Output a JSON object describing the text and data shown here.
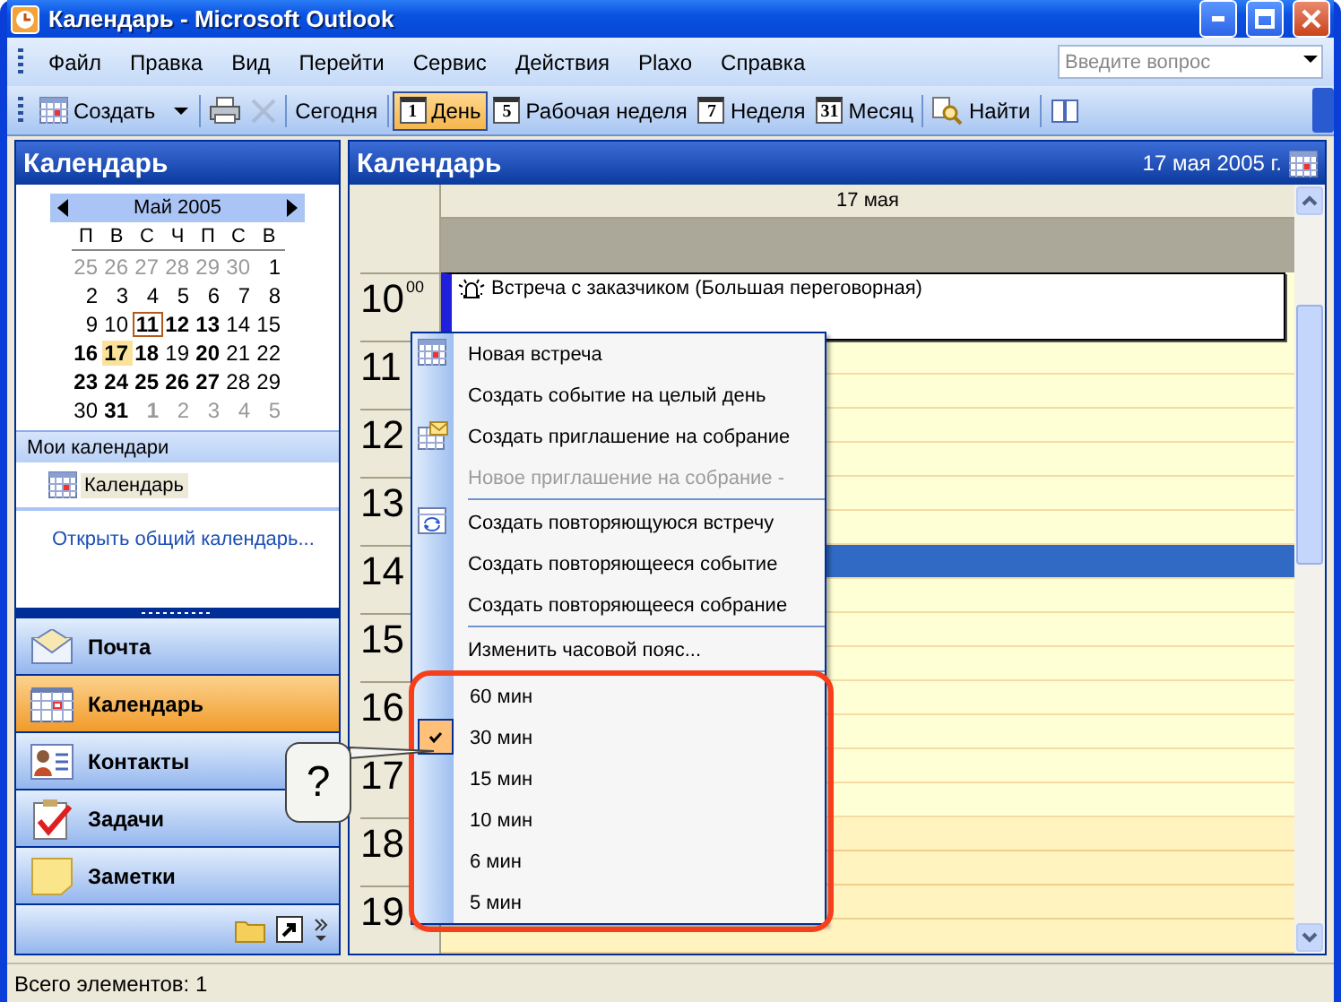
{
  "window": {
    "title": "Календарь - Microsoft Outlook"
  },
  "menu": [
    "Файл",
    "Правка",
    "Вид",
    "Перейти",
    "Сервис",
    "Действия",
    "Plaxo",
    "Справка"
  ],
  "help_search": {
    "placeholder": "Введите вопрос"
  },
  "toolbar": [
    {
      "kind": "new",
      "label": "Создать",
      "selected": false,
      "disabled": false
    },
    {
      "kind": "print",
      "selected": false,
      "disabled": false
    },
    {
      "kind": "delete",
      "selected": false,
      "disabled": true
    },
    {
      "kind": "text",
      "label": "Сегодня",
      "selected": false,
      "disabled": false
    },
    {
      "kind": "view",
      "icon_text": "1",
      "label": "День",
      "selected": true,
      "disabled": false
    },
    {
      "kind": "view",
      "icon_text": "5",
      "label": "Рабочая неделя",
      "selected": false,
      "disabled": false
    },
    {
      "kind": "view",
      "icon_text": "7",
      "label": "Неделя",
      "selected": false,
      "disabled": false
    },
    {
      "kind": "view",
      "icon_text": "31",
      "label": "Месяц",
      "selected": false,
      "disabled": false
    },
    {
      "kind": "find",
      "label": "Найти",
      "selected": false,
      "disabled": false
    },
    {
      "kind": "book",
      "selected": false,
      "disabled": false
    }
  ],
  "sidebar": {
    "title": "Календарь",
    "mini_calendar": {
      "month": "Май 2005",
      "weekdays": [
        "П",
        "В",
        "С",
        "Ч",
        "П",
        "С",
        "В"
      ],
      "weeks": [
        [
          {
            "d": "25",
            "other": true,
            "bold": false,
            "today": false,
            "selected": false
          },
          {
            "d": "26",
            "other": true,
            "bold": false,
            "today": false,
            "selected": false
          },
          {
            "d": "27",
            "other": true,
            "bold": false,
            "today": false,
            "selected": false
          },
          {
            "d": "28",
            "other": true,
            "bold": false,
            "today": false,
            "selected": false
          },
          {
            "d": "29",
            "other": true,
            "bold": false,
            "today": false,
            "selected": false
          },
          {
            "d": "30",
            "other": true,
            "bold": false,
            "today": false,
            "selected": false
          },
          {
            "d": "1",
            "other": false,
            "bold": false,
            "today": false,
            "selected": false
          }
        ],
        [
          {
            "d": "2",
            "other": false,
            "bold": false,
            "today": false,
            "selected": false
          },
          {
            "d": "3",
            "other": false,
            "bold": false,
            "today": false,
            "selected": false
          },
          {
            "d": "4",
            "other": false,
            "bold": false,
            "today": false,
            "selected": false
          },
          {
            "d": "5",
            "other": false,
            "bold": false,
            "today": false,
            "selected": false
          },
          {
            "d": "6",
            "other": false,
            "bold": false,
            "today": false,
            "selected": false
          },
          {
            "d": "7",
            "other": false,
            "bold": false,
            "today": false,
            "selected": false
          },
          {
            "d": "8",
            "other": false,
            "bold": false,
            "today": false,
            "selected": false
          }
        ],
        [
          {
            "d": "9",
            "other": false,
            "bold": false,
            "today": false,
            "selected": false
          },
          {
            "d": "10",
            "other": false,
            "bold": false,
            "today": false,
            "selected": false
          },
          {
            "d": "11",
            "other": false,
            "bold": true,
            "today": true,
            "selected": false
          },
          {
            "d": "12",
            "other": false,
            "bold": true,
            "today": false,
            "selected": false
          },
          {
            "d": "13",
            "other": false,
            "bold": true,
            "today": false,
            "selected": false
          },
          {
            "d": "14",
            "other": false,
            "bold": false,
            "today": false,
            "selected": false
          },
          {
            "d": "15",
            "other": false,
            "bold": false,
            "today": false,
            "selected": false
          }
        ],
        [
          {
            "d": "16",
            "other": false,
            "bold": true,
            "today": false,
            "selected": false
          },
          {
            "d": "17",
            "other": false,
            "bold": true,
            "today": false,
            "selected": true
          },
          {
            "d": "18",
            "other": false,
            "bold": true,
            "today": false,
            "selected": false
          },
          {
            "d": "19",
            "other": false,
            "bold": false,
            "today": false,
            "selected": false
          },
          {
            "d": "20",
            "other": false,
            "bold": true,
            "today": false,
            "selected": false
          },
          {
            "d": "21",
            "other": false,
            "bold": false,
            "today": false,
            "selected": false
          },
          {
            "d": "22",
            "other": false,
            "bold": false,
            "today": false,
            "selected": false
          }
        ],
        [
          {
            "d": "23",
            "other": false,
            "bold": true,
            "today": false,
            "selected": false
          },
          {
            "d": "24",
            "other": false,
            "bold": true,
            "today": false,
            "selected": false
          },
          {
            "d": "25",
            "other": false,
            "bold": true,
            "today": false,
            "selected": false
          },
          {
            "d": "26",
            "other": false,
            "bold": true,
            "today": false,
            "selected": false
          },
          {
            "d": "27",
            "other": false,
            "bold": true,
            "today": false,
            "selected": false
          },
          {
            "d": "28",
            "other": false,
            "bold": false,
            "today": false,
            "selected": false
          },
          {
            "d": "29",
            "other": false,
            "bold": false,
            "today": false,
            "selected": false
          }
        ],
        [
          {
            "d": "30",
            "other": false,
            "bold": false,
            "today": false,
            "selected": false
          },
          {
            "d": "31",
            "other": false,
            "bold": true,
            "today": false,
            "selected": false
          },
          {
            "d": "1",
            "other": true,
            "bold": true,
            "today": false,
            "selected": false
          },
          {
            "d": "2",
            "other": true,
            "bold": false,
            "today": false,
            "selected": false
          },
          {
            "d": "3",
            "other": true,
            "bold": false,
            "today": false,
            "selected": false
          },
          {
            "d": "4",
            "other": true,
            "bold": false,
            "today": false,
            "selected": false
          },
          {
            "d": "5",
            "other": true,
            "bold": false,
            "today": false,
            "selected": false
          }
        ]
      ]
    },
    "my_calendars": {
      "title": "Мои календари",
      "items": [
        {
          "label": "Календарь",
          "selected": true
        }
      ]
    },
    "link": "Открыть общий календарь...",
    "nav": [
      {
        "kind": "mail",
        "label": "Почта",
        "selected": false
      },
      {
        "kind": "calendar",
        "label": "Календарь",
        "selected": true
      },
      {
        "kind": "contacts",
        "label": "Контакты",
        "selected": false
      },
      {
        "kind": "tasks",
        "label": "Задачи",
        "selected": false
      },
      {
        "kind": "notes",
        "label": "Заметки",
        "selected": false
      }
    ]
  },
  "main": {
    "title": "Календарь",
    "date": "17 мая 2005 г.",
    "day_header": "17 мая",
    "hours": [
      {
        "hour": "10",
        "minutes": "00",
        "working": true,
        "selected": false,
        "appointment": {
          "title": "Встреча с заказчиком (Большая переговорная)",
          "reminder": true
        }
      },
      {
        "hour": "11",
        "working": true,
        "selected": false
      },
      {
        "hour": "12",
        "working": true,
        "selected": false
      },
      {
        "hour": "13",
        "working": true,
        "selected": false
      },
      {
        "hour": "14",
        "working": true,
        "selected": true
      },
      {
        "hour": "15",
        "working": true,
        "selected": false
      },
      {
        "hour": "16",
        "working": true,
        "selected": false
      },
      {
        "hour": "17",
        "working": true,
        "selected": false
      },
      {
        "hour": "18",
        "working": false,
        "selected": false
      },
      {
        "hour": "19",
        "working": false,
        "selected": false
      }
    ]
  },
  "context_menu": [
    {
      "kind": "item",
      "label": "Новая встреча",
      "disabled": false,
      "checked": false
    },
    {
      "kind": "item",
      "label": "Создать событие на целый день",
      "disabled": false,
      "checked": false
    },
    {
      "kind": "item",
      "label": "Создать приглашение на собрание",
      "disabled": false,
      "checked": false
    },
    {
      "kind": "item",
      "label": "Новое приглашение на собрание -",
      "disabled": true,
      "checked": false
    },
    {
      "kind": "separator"
    },
    {
      "kind": "item",
      "label": "Создать повторяющуюся встречу",
      "disabled": false,
      "checked": false
    },
    {
      "kind": "item",
      "label": "Создать повторяющееся событие",
      "disabled": false,
      "checked": false
    },
    {
      "kind": "item",
      "label": "Создать повторяющееся собрание",
      "disabled": false,
      "checked": false
    },
    {
      "kind": "separator"
    },
    {
      "kind": "item",
      "label": "Изменить часовой пояс...",
      "disabled": false,
      "checked": false
    },
    {
      "kind": "separator"
    },
    {
      "kind": "item",
      "label": "60 мин",
      "disabled": false,
      "checked": false
    },
    {
      "kind": "item",
      "label": "30 мин",
      "disabled": false,
      "checked": true
    },
    {
      "kind": "item",
      "label": "15 мин",
      "disabled": false,
      "checked": false
    },
    {
      "kind": "item",
      "label": "10 мин",
      "disabled": false,
      "checked": false
    },
    {
      "kind": "item",
      "label": "6 мин",
      "disabled": false,
      "checked": false
    },
    {
      "kind": "item",
      "label": "5 мин",
      "disabled": false,
      "checked": false
    }
  ],
  "callout": {
    "text": "?"
  },
  "status_bar": {
    "text": "Всего элементов: 1"
  }
}
